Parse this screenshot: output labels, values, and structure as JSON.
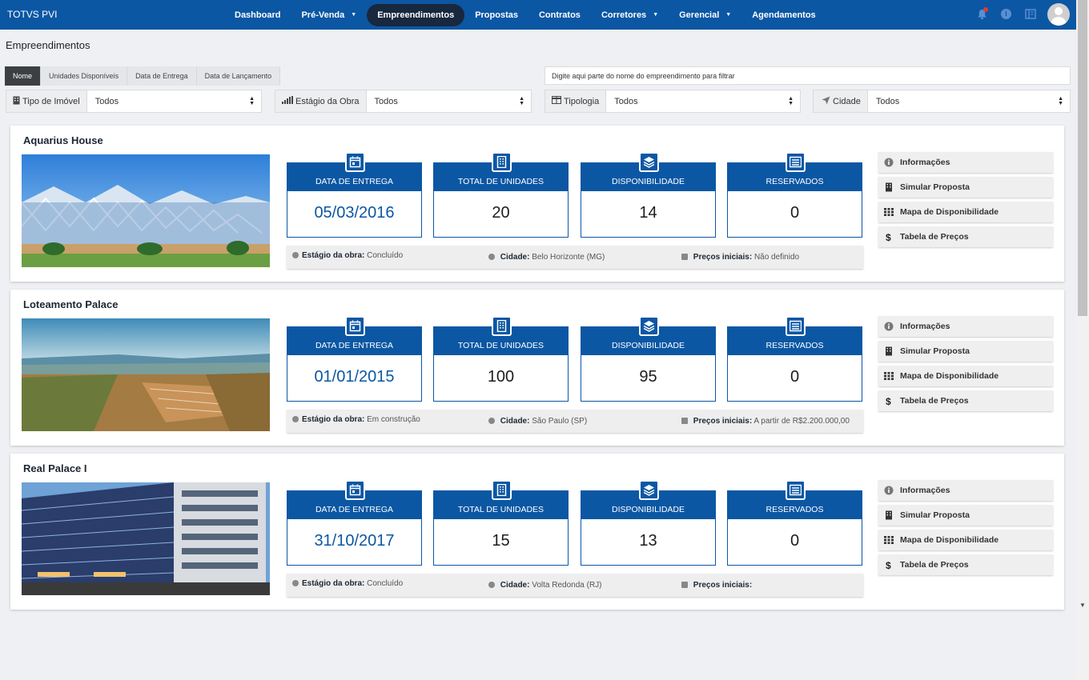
{
  "app": {
    "brand": "TOTVS PVI"
  },
  "nav": [
    {
      "label": "Dashboard",
      "active": false
    },
    {
      "label": "Pré-Venda",
      "active": false,
      "dropdown": true
    },
    {
      "label": "Empreendimentos",
      "active": true
    },
    {
      "label": "Propostas",
      "active": false
    },
    {
      "label": "Contratos",
      "active": false
    },
    {
      "label": "Corretores",
      "active": false,
      "dropdown": true
    },
    {
      "label": "Gerencial",
      "active": false,
      "dropdown": true
    },
    {
      "label": "Agendamentos",
      "active": false
    }
  ],
  "page": {
    "title": "Empreendimentos"
  },
  "sort_tabs": [
    "Nome",
    "Unidades Disponíveis",
    "Data de Entrega",
    "Data de Lançamento"
  ],
  "filter": {
    "placeholder": "Digite aqui parte do nome do empreendimento para filtrar"
  },
  "selects": [
    {
      "label": "Tipo de Imóvel",
      "value": "Todos"
    },
    {
      "label": "Estágio da Obra",
      "value": "Todos"
    },
    {
      "label": "Tipologia",
      "value": "Todos"
    },
    {
      "label": "Cidade",
      "value": "Todos"
    }
  ],
  "stat_labels": {
    "delivery": "DATA DE ENTREGA",
    "total": "TOTAL DE UNIDADES",
    "available": "DISPONIBILIDADE",
    "reserved": "RESERVADOS"
  },
  "info_labels": {
    "stage": "Estágio da obra:",
    "city": "Cidade:",
    "price": "Preços iniciais:"
  },
  "actions": [
    "Informações",
    "Simular Proposta",
    "Mapa de Disponibilidade",
    "Tabela de Preços"
  ],
  "projects": [
    {
      "name": "Aquarius House",
      "delivery": "05/03/2016",
      "total": "20",
      "available": "14",
      "reserved": "0",
      "stage": "Concluído",
      "city": "Belo Horizonte (MG)",
      "price": "Não definido"
    },
    {
      "name": "Loteamento Palace",
      "delivery": "01/01/2015",
      "total": "100",
      "available": "95",
      "reserved": "0",
      "stage": "Em construção",
      "city": "São Paulo (SP)",
      "price": "A partir de R$2.200.000,00"
    },
    {
      "name": "Real Palace I",
      "delivery": "31/10/2017",
      "total": "15",
      "available": "13",
      "reserved": "0",
      "stage": "Concluído",
      "city": "Volta Redonda (RJ)",
      "price": ""
    }
  ]
}
